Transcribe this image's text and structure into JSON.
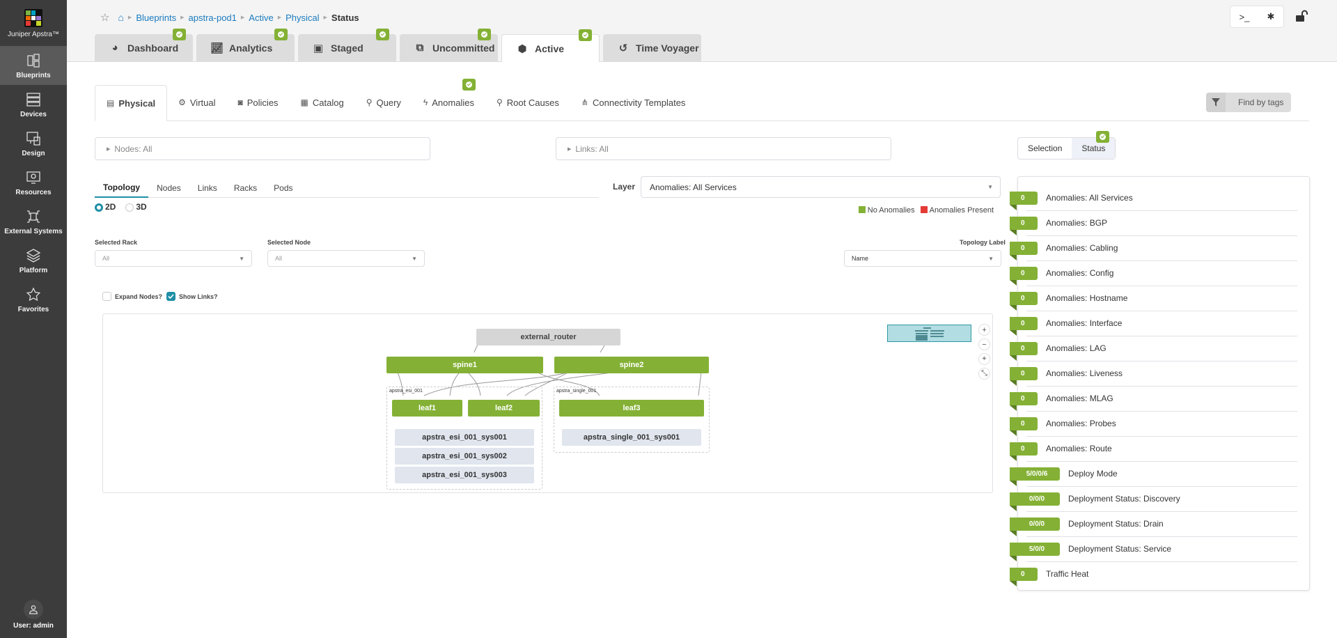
{
  "app": {
    "name": "Juniper Apstra™"
  },
  "sidebar": {
    "items": [
      {
        "label": "Blueprints",
        "icon": "blueprints-icon",
        "active": true
      },
      {
        "label": "Devices",
        "icon": "devices-icon"
      },
      {
        "label": "Design",
        "icon": "design-icon"
      },
      {
        "label": "Resources",
        "icon": "resources-icon"
      },
      {
        "label": "External Systems",
        "icon": "external-systems-icon"
      },
      {
        "label": "Platform",
        "icon": "platform-icon"
      },
      {
        "label": "Favorites",
        "icon": "star-icon"
      }
    ],
    "user": "User: admin"
  },
  "breadcrumb": [
    "Blueprints",
    "apstra-pod1",
    "Active",
    "Physical",
    "Status"
  ],
  "top_tabs": [
    {
      "label": "Dashboard",
      "icon": "dashboard-icon",
      "badge": true
    },
    {
      "label": "Analytics",
      "icon": "analytics-icon",
      "badge": true
    },
    {
      "label": "Staged",
      "icon": "staged-icon",
      "badge": true
    },
    {
      "label": "Uncommitted",
      "icon": "uncommitted-icon",
      "badge": true
    },
    {
      "label": "Active",
      "icon": "active-icon",
      "badge": true,
      "active": true
    },
    {
      "label": "Time Voyager",
      "icon": "history-icon"
    }
  ],
  "toolbar": {
    "terminal": ">_",
    "bug": "bug-icon",
    "lock": "unlock-icon"
  },
  "sub_tabs": [
    {
      "label": "Physical",
      "active": true
    },
    {
      "label": "Virtual"
    },
    {
      "label": "Policies"
    },
    {
      "label": "Catalog"
    },
    {
      "label": "Query"
    },
    {
      "label": "Anomalies",
      "badge": true
    },
    {
      "label": "Root Causes"
    },
    {
      "label": "Connectivity Templates"
    }
  ],
  "find_by_tags": "Find by tags",
  "filters": {
    "nodes": "Nodes: All",
    "links": "Links: All"
  },
  "panel_toggle": {
    "selection": "Selection",
    "status": "Status"
  },
  "view_tabs": [
    "Topology",
    "Nodes",
    "Links",
    "Racks",
    "Pods"
  ],
  "dimension": {
    "options": [
      "2D",
      "3D"
    ],
    "selected": "2D"
  },
  "layer": {
    "label": "Layer",
    "value": "Anomalies: All Services"
  },
  "legend": [
    {
      "label": "No Anomalies",
      "color": "#84b135"
    },
    {
      "label": "Anomalies Present",
      "color": "#e53935"
    }
  ],
  "selected_rack": {
    "label": "Selected Rack",
    "value": "All"
  },
  "selected_node": {
    "label": "Selected Node",
    "value": "All"
  },
  "topology_label": {
    "label": "Topology Label",
    "value": "Name"
  },
  "checkboxes": [
    {
      "label": "Expand Nodes?",
      "checked": false
    },
    {
      "label": "Show Links?",
      "checked": true
    }
  ],
  "topology": {
    "external": "external_router",
    "spines": [
      "spine1",
      "spine2"
    ],
    "racks": [
      {
        "name": "apstra_esi_001",
        "leafs": [
          "leaf1",
          "leaf2"
        ],
        "systems": [
          "apstra_esi_001_sys001",
          "apstra_esi_001_sys002",
          "apstra_esi_001_sys003"
        ]
      },
      {
        "name": "apstra_single_001",
        "leafs": [
          "leaf3"
        ],
        "systems": [
          "apstra_single_001_sys001"
        ]
      }
    ]
  },
  "status": [
    {
      "value": "0",
      "label": "Anomalies: All Services"
    },
    {
      "value": "0",
      "label": "Anomalies: BGP"
    },
    {
      "value": "0",
      "label": "Anomalies: Cabling"
    },
    {
      "value": "0",
      "label": "Anomalies: Config"
    },
    {
      "value": "0",
      "label": "Anomalies: Hostname"
    },
    {
      "value": "0",
      "label": "Anomalies: Interface"
    },
    {
      "value": "0",
      "label": "Anomalies: LAG"
    },
    {
      "value": "0",
      "label": "Anomalies: Liveness"
    },
    {
      "value": "0",
      "label": "Anomalies: MLAG"
    },
    {
      "value": "0",
      "label": "Anomalies: Probes"
    },
    {
      "value": "0",
      "label": "Anomalies: Route"
    },
    {
      "value": "5/0/0/6",
      "label": "Deploy Mode"
    },
    {
      "value": "0/0/0",
      "label": "Deployment Status: Discovery"
    },
    {
      "value": "0/0/0",
      "label": "Deployment Status: Drain"
    },
    {
      "value": "5/0/0",
      "label": "Deployment Status: Service"
    },
    {
      "value": "0",
      "label": "Traffic Heat"
    }
  ]
}
